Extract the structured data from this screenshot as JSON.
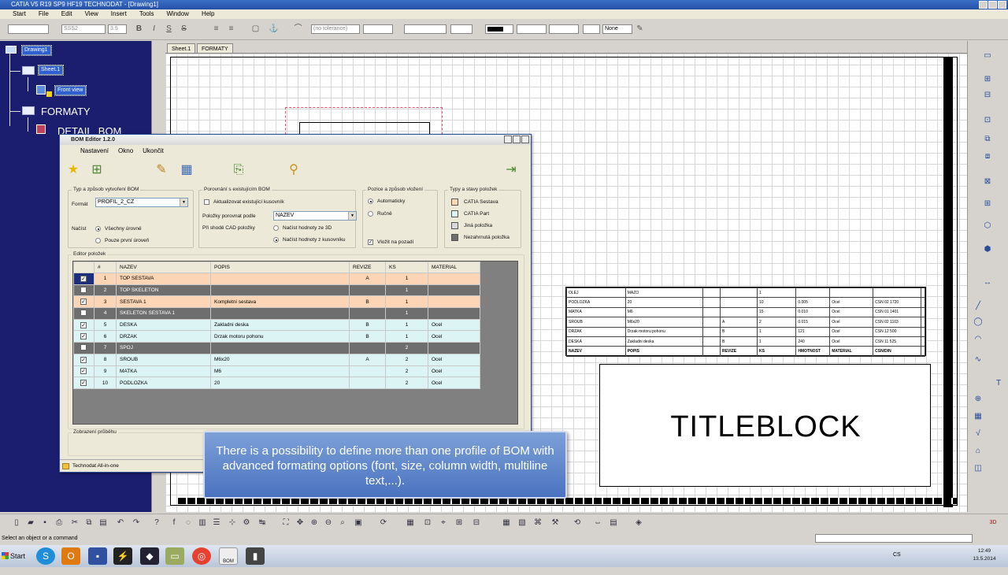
{
  "app": {
    "title": "CATIA V5 R19 SP9 HF19 TECHNODAT - [Drawing1]",
    "menu": [
      "Start",
      "File",
      "Edit",
      "View",
      "Insert",
      "Tools",
      "Window",
      "Help"
    ]
  },
  "toolbar1": {
    "font_name": "SSS2",
    "font_size": "3.5",
    "tolerance": "(no tolerance)",
    "line_none": "None"
  },
  "tree": {
    "root": "Drawing1",
    "sheet": "Sheet.1",
    "view": "Front view",
    "formaty": "FORMATY",
    "detail": "DETAIL_BOM"
  },
  "sheet_tabs": [
    "Sheet.1",
    "FORMATY"
  ],
  "drawing": {
    "titleblock": "TITLEBLOCK",
    "bom_rows": [
      [
        "OLEJ",
        "MAZO",
        "",
        "",
        "1",
        "",
        "",
        "",
        ""
      ],
      [
        "PODLOZKA",
        "20",
        "",
        "",
        "10",
        "0.005",
        "Ocel",
        "CSN 02 1720",
        ""
      ],
      [
        "MATKA",
        "M6",
        "",
        "",
        "15",
        "0.010",
        "Ocel",
        "CSN 01 1401",
        ""
      ],
      [
        "SROUB",
        "M6x20",
        "",
        "A",
        "2",
        "0.015",
        "Ocel",
        "CSN 02 1103",
        ""
      ],
      [
        "DRZAK",
        "Drzak motoru pohonu",
        "",
        "B",
        "1",
        "121",
        "Ocel",
        "CSN 12 500",
        ""
      ],
      [
        "DESKA",
        "Zakladni deska",
        "",
        "B",
        "1",
        "240",
        "Ocel",
        "CSN 11 525",
        ""
      ],
      [
        "NAZEV",
        "POPIS",
        "",
        "REVIZE",
        "KS",
        "HMOTNOST",
        "MATERIAL",
        "CSN/DIN",
        ""
      ]
    ]
  },
  "bom_editor": {
    "title": "BOM Editor 1.2.0",
    "menu": [
      "Nastavení",
      "Okno",
      "Ukončit"
    ],
    "group1": {
      "title": "Typ a způsob vytvoření BOM",
      "format_label": "Formát",
      "format_value": "PROFIL_2_CZ",
      "load_label": "Načíst",
      "opt_all": "Všechny úrovně",
      "opt_first": "Pouze první úroveň"
    },
    "group2": {
      "title": "Porovnání s existujícím BOM",
      "chk_update": "Aktualizovat existující kusovník",
      "compare_label": "Položky porovnat podle",
      "compare_value": "NAZEV",
      "match_label": "Při shodě CAD položky",
      "opt_3d": "Načíst hodnoty ze 3D",
      "opt_bom": "Načíst hodnoty z kusovníku"
    },
    "group3": {
      "title": "Pozice a způsob vložení",
      "opt_auto": "Automaticky",
      "opt_manual": "Ručně",
      "chk_background": "Vložit na pozadí"
    },
    "group4": {
      "title": "Typy a stavy položek",
      "items": [
        {
          "label": "CATIA Sestava",
          "color": "#fbd5b5"
        },
        {
          "label": "CATIA Part",
          "color": "#dcf4f4"
        },
        {
          "label": "Jiná položka",
          "color": "#d9d9d9"
        },
        {
          "label": "Nezahrnutá položka",
          "color": "#6e6e6e"
        }
      ]
    },
    "editor_title": "Editor položek",
    "columns": [
      "",
      "#",
      "NAZEV",
      "POPIS",
      "REVIZE",
      "KS",
      "MATERIAL"
    ],
    "rows": [
      {
        "checked": true,
        "n": "1",
        "nazev": "TOP SESTAVA",
        "popis": "",
        "revize": "A",
        "ks": "1",
        "material": "",
        "type": "orange"
      },
      {
        "checked": false,
        "n": "2",
        "nazev": "TOP SKELETON",
        "popis": "",
        "revize": "",
        "ks": "1",
        "material": "",
        "type": "dark"
      },
      {
        "checked": true,
        "n": "3",
        "nazev": "SESTAVA 1",
        "popis": "Kompletni sestava",
        "revize": "B",
        "ks": "1",
        "material": "",
        "type": "orange"
      },
      {
        "checked": false,
        "n": "4",
        "nazev": "SKELETON SESTAVA 1",
        "popis": "",
        "revize": "",
        "ks": "1",
        "material": "",
        "type": "dark"
      },
      {
        "checked": true,
        "n": "5",
        "nazev": "DESKA",
        "popis": "Zakladni deska",
        "revize": "B",
        "ks": "1",
        "material": "Ocel",
        "type": "cyan"
      },
      {
        "checked": true,
        "n": "6",
        "nazev": "DRZAK",
        "popis": "Drzak motoru pohonu",
        "revize": "B",
        "ks": "1",
        "material": "Ocel",
        "type": "cyan"
      },
      {
        "checked": false,
        "n": "7",
        "nazev": "SPOJ",
        "popis": "",
        "revize": "",
        "ks": "2",
        "material": "",
        "type": "dark"
      },
      {
        "checked": true,
        "n": "8",
        "nazev": "SROUB",
        "popis": "M6x20",
        "revize": "A",
        "ks": "2",
        "material": "Ocel",
        "type": "cyan"
      },
      {
        "checked": true,
        "n": "9",
        "nazev": "MATKA",
        "popis": "M6",
        "revize": "",
        "ks": "2",
        "material": "Ocel",
        "type": "cyan"
      },
      {
        "checked": true,
        "n": "10",
        "nazev": "PODLOZKA",
        "popis": "20",
        "revize": "",
        "ks": "2",
        "material": "Ocel",
        "type": "cyan"
      }
    ],
    "progress_title": "Zobrazení průběhu",
    "status": "Technodat All-in-one"
  },
  "tooltip": "There is a possibility to define more than one profile of BOM with advanced formating options (font, size, column width, multiline text,...).",
  "statusbar": {
    "text": "Select an object or a command"
  },
  "taskbar": {
    "start": "Start",
    "bom_label": "BOM",
    "lang": "CS",
    "time": "12:49",
    "date": "13.5.2014"
  }
}
